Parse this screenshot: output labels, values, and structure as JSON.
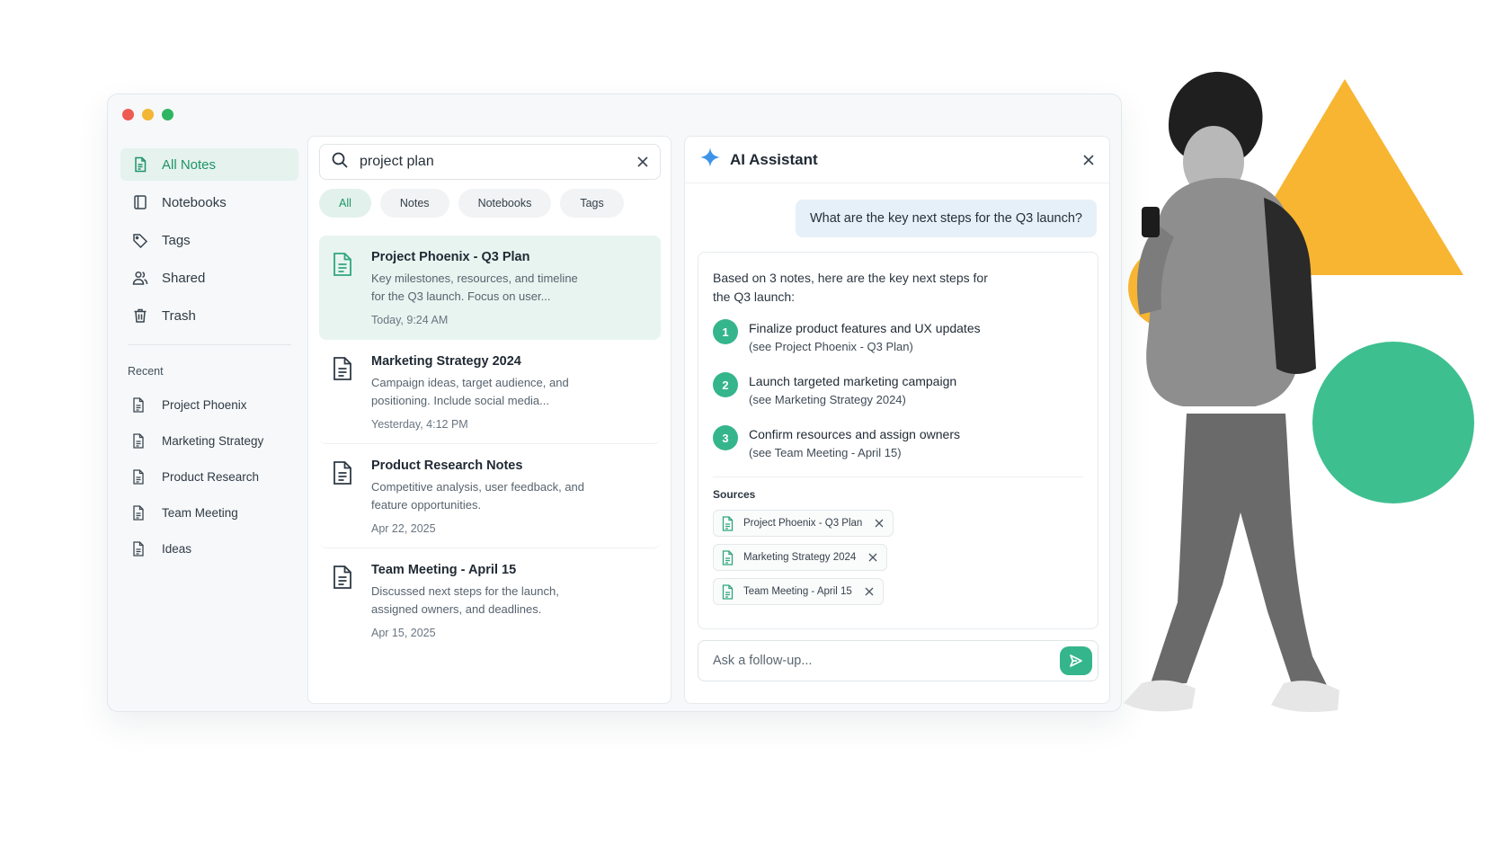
{
  "window": {
    "controls": [
      {
        "name": "close",
        "color": "#ed5b52"
      },
      {
        "name": "minimize",
        "color": "#f2b534"
      },
      {
        "name": "maximize",
        "color": "#2fb561"
      }
    ]
  },
  "colors": {
    "accent": "#35b58b",
    "accent_text": "#1e9468",
    "ai_icon": "#3e93e8"
  },
  "sidebar": {
    "items": [
      {
        "label": "All Notes",
        "icon": "note-icon"
      },
      {
        "label": "Notebooks",
        "icon": "notebook-icon"
      },
      {
        "label": "Tags",
        "icon": "tag-icon"
      },
      {
        "label": "Shared",
        "icon": "people-icon"
      },
      {
        "label": "Trash",
        "icon": "trash-icon"
      }
    ],
    "recent_heading": "Recent",
    "recent": [
      "Project Phoenix",
      "Marketing Strategy",
      "Product Research",
      "Team Meeting",
      "Ideas"
    ]
  },
  "search": {
    "value": "project plan"
  },
  "filters": [
    "All",
    "Notes",
    "Notebooks",
    "Tags"
  ],
  "notes": [
    {
      "title": "Project Phoenix - Q3 Plan",
      "snippet": "Key milestones, resources, and timeline for the Q3 launch. Focus on user...",
      "date": "Today, 9:24 AM"
    },
    {
      "title": "Marketing Strategy 2024",
      "snippet": "Campaign ideas, target audience, and positioning. Include social media...",
      "date": "Yesterday, 4:12 PM"
    },
    {
      "title": "Product Research Notes",
      "snippet": "Competitive analysis, user feedback, and feature opportunities.",
      "date": "Apr 22, 2025"
    },
    {
      "title": "Team Meeting - April 15",
      "snippet": "Discussed next steps for the launch, assigned owners, and deadlines.",
      "date": "Apr 15, 2025"
    }
  ],
  "ai": {
    "title": "AI Assistant",
    "question": "What are the key next steps for the Q3 launch?",
    "intro": "Based on 3 notes, here are the key next steps for the Q3 launch:",
    "steps": [
      {
        "num": "1",
        "title": "Finalize product features and UX updates",
        "ref": "(see Project Phoenix - Q3 Plan)"
      },
      {
        "num": "2",
        "title": "Launch targeted marketing campaign",
        "ref": "(see Marketing Strategy 2024)"
      },
      {
        "num": "3",
        "title": "Confirm resources and assign owners",
        "ref": "(see Team Meeting - April 15)"
      }
    ],
    "sources_heading": "Sources",
    "sources": [
      "Project Phoenix - Q3 Plan",
      "Marketing Strategy 2024",
      "Team Meeting - April 15"
    ],
    "followup_placeholder": "Ask a follow-up..."
  },
  "illustration": {
    "triangle_color": "#f7b531",
    "circle_color": "#3ebf8f"
  }
}
